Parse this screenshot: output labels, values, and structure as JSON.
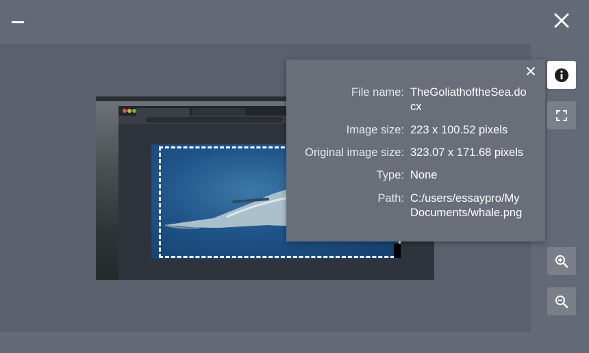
{
  "window": {
    "minimize_icon": "minimize-icon",
    "close_icon": "close-icon"
  },
  "toolbar": {
    "info_icon": "info-icon",
    "fullscreen_icon": "fullscreen-icon",
    "zoom_in_icon": "zoom-in-icon",
    "zoom_out_icon": "zoom-out-icon"
  },
  "info_panel": {
    "close_icon": "close-icon",
    "fields": [
      {
        "label": "File name:",
        "value": "TheGoliathoftheSea.docx"
      },
      {
        "label": "Image size:",
        "value": "223 x 100.52 pixels"
      },
      {
        "label": "Original image size:",
        "value": "323.07 x 171.68 pixels"
      },
      {
        "label": "Type:",
        "value": "None"
      },
      {
        "label": "Path:",
        "value": "C:/users/essaypro/My Documents/whale.png"
      }
    ]
  },
  "colors": {
    "background": "#5b606d",
    "bars": "#646977",
    "panel": "#6a6e79",
    "whale_sea": "#1f5387"
  }
}
